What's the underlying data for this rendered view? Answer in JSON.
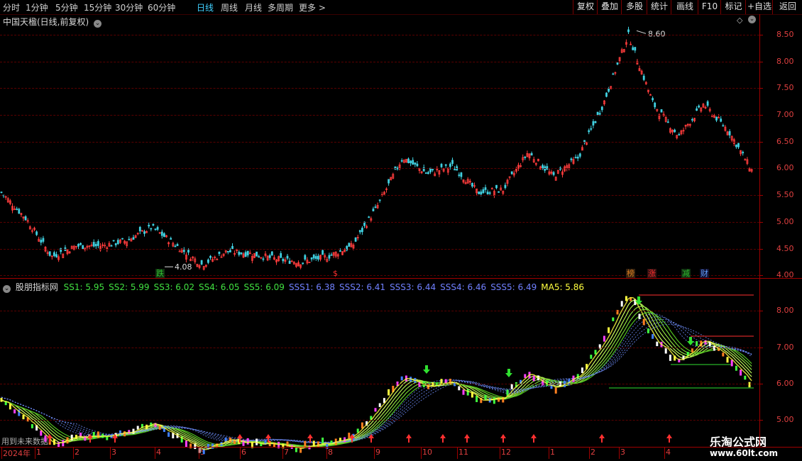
{
  "toolbar": {
    "periods": [
      {
        "label": "分时",
        "active": false
      },
      {
        "label": "1分钟",
        "active": false
      },
      {
        "label": "5分钟",
        "active": false
      },
      {
        "label": "15分钟",
        "active": false
      },
      {
        "label": "30分钟",
        "active": false
      },
      {
        "label": "60分钟",
        "active": false
      },
      {
        "label": "日线",
        "active": true
      },
      {
        "label": "周线",
        "active": false
      },
      {
        "label": "月线",
        "active": false
      },
      {
        "label": "多周期",
        "active": false
      },
      {
        "label": "更多 >",
        "active": false
      }
    ],
    "buttons": [
      "复权",
      "叠加",
      "多股",
      "统计",
      "画线",
      "F10",
      "标记",
      "+自选",
      "返回"
    ]
  },
  "main_panel": {
    "title": "中国天楹(日线,前复权)",
    "y_labels": [
      "8.50",
      "8.00",
      "7.50",
      "7.00",
      "6.50",
      "6.00",
      "5.50",
      "5.00",
      "4.50",
      "4.00"
    ],
    "high_label": "8.60",
    "low_label": "4.08",
    "tags": [
      {
        "text": "跌",
        "color": "#30c030",
        "bg": "#103010"
      },
      {
        "text": "$",
        "color": "#ff3030",
        "bg": "transparent"
      },
      {
        "text": "榜",
        "color": "#e08020",
        "bg": "#302010"
      },
      {
        "text": "涨",
        "color": "#ff3030",
        "bg": "#301010"
      },
      {
        "text": "减",
        "color": "#30c030",
        "bg": "#103010"
      },
      {
        "text": "财",
        "color": "#60a0ff",
        "bg": "#101030"
      }
    ]
  },
  "indicator_panel": {
    "name": "股朋指标网",
    "values": [
      {
        "label": "SS1: 5.95",
        "color": "#40e040"
      },
      {
        "label": "SS2: 5.99",
        "color": "#40e040"
      },
      {
        "label": "SS3: 6.02",
        "color": "#40e040"
      },
      {
        "label": "SS4: 6.05",
        "color": "#40e040"
      },
      {
        "label": "SS5: 6.09",
        "color": "#40e040"
      },
      {
        "label": "SSS1: 6.38",
        "color": "#7080ff"
      },
      {
        "label": "SSS2: 6.41",
        "color": "#7080ff"
      },
      {
        "label": "SSS3: 6.44",
        "color": "#7080ff"
      },
      {
        "label": "SSS4: 6.46",
        "color": "#7080ff"
      },
      {
        "label": "SSS5: 6.49",
        "color": "#7080ff"
      },
      {
        "label": "MA5: 5.86",
        "color": "#ffff40"
      }
    ],
    "y_labels": [
      "8.00",
      "7.00",
      "6.00",
      "5.00"
    ],
    "footer_note": "用到未来数据"
  },
  "x_axis": {
    "labels": [
      "2024年",
      "1",
      "2",
      "3",
      "4",
      "5",
      "6",
      "7",
      "8",
      "9",
      "10",
      "11",
      "12",
      "1",
      "2",
      "3",
      "4"
    ]
  },
  "watermark": {
    "line1": "乐淘公式网",
    "line2": "www.60lt.com"
  },
  "chart_data": {
    "type": "line",
    "title": "中国天楹(日线,前复权)",
    "x_months": [
      "1",
      "2",
      "3",
      "4",
      "5",
      "6",
      "7",
      "8",
      "9",
      "10",
      "11",
      "12",
      "1",
      "2",
      "3",
      "4"
    ],
    "price_close_approx": [
      5.55,
      5.05,
      4.35,
      4.55,
      4.55,
      4.65,
      4.9,
      4.55,
      4.2,
      4.45,
      4.4,
      4.3,
      4.25,
      4.35,
      4.55,
      5.3,
      6.2,
      5.9,
      6.05,
      5.55,
      5.6,
      6.3,
      5.85,
      6.2,
      7.2,
      8.5,
      7.2,
      6.6,
      7.2,
      6.7,
      5.9
    ],
    "ylim_main": [
      3.95,
      8.75
    ],
    "marked_high": 8.6,
    "marked_low": 4.08,
    "ylim_indicator": [
      4.75,
      8.55
    ],
    "indicator_series": [
      {
        "name": "SS1",
        "last": 5.95
      },
      {
        "name": "SS2",
        "last": 5.99
      },
      {
        "name": "SS3",
        "last": 6.02
      },
      {
        "name": "SS4",
        "last": 6.05
      },
      {
        "name": "SS5",
        "last": 6.09
      },
      {
        "name": "SSS1",
        "last": 6.38
      },
      {
        "name": "SSS2",
        "last": 6.41
      },
      {
        "name": "SSS3",
        "last": 6.44
      },
      {
        "name": "SSS4",
        "last": 6.46
      },
      {
        "name": "SSS5",
        "last": 6.49
      },
      {
        "name": "MA5",
        "last": 5.86
      }
    ]
  }
}
